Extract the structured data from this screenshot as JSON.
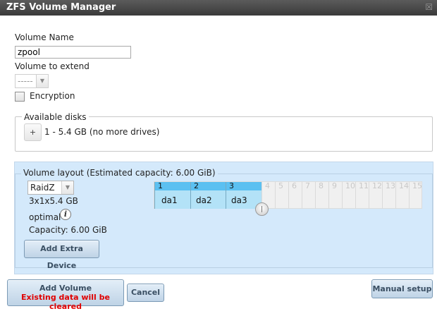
{
  "window": {
    "title": "ZFS Volume Manager",
    "close_glyph": "☒"
  },
  "form": {
    "volume_name_label": "Volume Name",
    "volume_name_value": "zpool",
    "volume_to_extend_label": "Volume to extend",
    "volume_to_extend_value": "-----",
    "encryption_label": "Encryption",
    "encryption_checked": false
  },
  "available_disks": {
    "legend": "Available disks",
    "add_glyph": "+",
    "disk_group_text": "1 - 5.4 GB (no more drives)"
  },
  "volume_layout": {
    "legend": "Volume layout (Estimated capacity: 6.00 GiB)",
    "raid_type": "RaidZ",
    "disk_summary": "3x1x5.4 GB",
    "status": "optimal",
    "capacity_text": "Capacity: 6.00 GiB",
    "add_extra_device_label": "Add Extra Device",
    "columns": [
      "1",
      "2",
      "3",
      "4",
      "5",
      "6",
      "7",
      "8",
      "9",
      "10",
      "11",
      "12",
      "13",
      "14",
      "15"
    ],
    "selected_columns": 3,
    "disks": [
      "da1",
      "da2",
      "da3"
    ]
  },
  "buttons": {
    "add_volume_label": "Add Volume",
    "add_volume_warning": "Existing data will be cleared",
    "cancel_label": "Cancel",
    "manual_setup_label": "Manual setup"
  },
  "colors": {
    "selected_header": "#5bc0f1",
    "selected_cell": "#b3e2f7",
    "panel_bg": "#d4e9fb",
    "warning_text": "#e00000"
  }
}
